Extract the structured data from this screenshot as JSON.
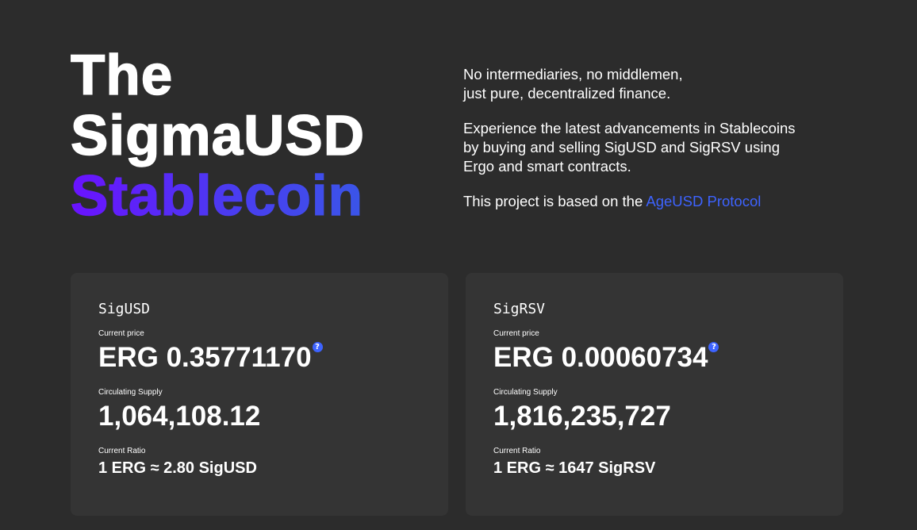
{
  "hero": {
    "title_line1": "The",
    "title_line2": "SigmaUSD",
    "title_line3": "Stablecoin"
  },
  "intro": {
    "line1": "No intermediaries, no middlemen,",
    "line2": "just pure, decentralized finance.",
    "para2": "Experience the latest advancements in Stablecoins by buying and selling SigUSD and SigRSV using Ergo and smart contracts.",
    "para3_prefix": "This project is based on the ",
    "para3_link": "AgeUSD Protocol"
  },
  "cards": [
    {
      "title": "SigUSD",
      "price_label": "Current price",
      "price": "ERG 0.35771170",
      "help": "?",
      "supply_label": "Circulating Supply",
      "supply": "1,064,108.12",
      "ratio_label": "Current Ratio",
      "ratio": "1 ERG ≈ 2.80 SigUSD"
    },
    {
      "title": "SigRSV",
      "price_label": "Current price",
      "price": "ERG 0.00060734",
      "help": "?",
      "supply_label": "Circulating Supply",
      "supply": "1,816,235,727",
      "ratio_label": "Current Ratio",
      "ratio": "1 ERG ≈ 1647 SigRSV"
    }
  ],
  "colors": {
    "background": "#2c2c2c",
    "card": "#343434",
    "accent_link": "#3d63ff",
    "gradient_start": "#6a12ff",
    "gradient_end": "#3a55e8"
  },
  "icons": {
    "help": "question-circle-icon"
  }
}
